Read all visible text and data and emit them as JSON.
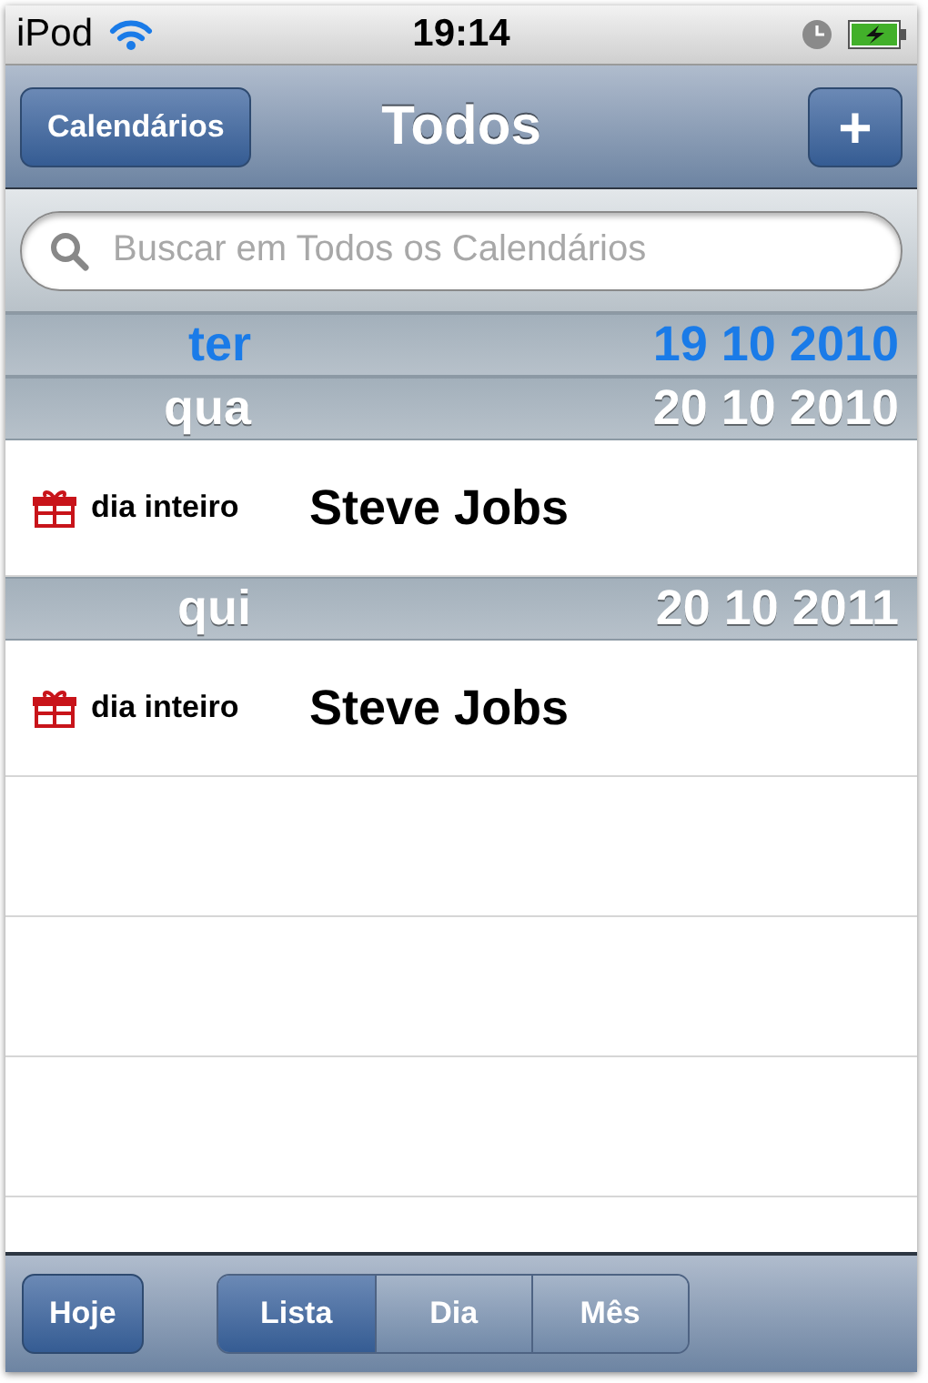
{
  "status_bar": {
    "device": "iPod",
    "time": "19:14"
  },
  "nav_bar": {
    "back_button": "Calendários",
    "title": "Todos",
    "add_button": "+"
  },
  "search": {
    "placeholder": "Buscar em Todos os Calendários"
  },
  "sections": [
    {
      "weekday": "ter",
      "date": "19 10 2010",
      "today": true
    },
    {
      "weekday": "qua",
      "date": "20 10 2010",
      "today": false,
      "events": [
        {
          "time": "dia inteiro",
          "title": "Steve Jobs"
        }
      ]
    },
    {
      "weekday": "qui",
      "date": "20 10 2011",
      "today": false,
      "events": [
        {
          "time": "dia inteiro",
          "title": "Steve Jobs"
        }
      ]
    }
  ],
  "toolbar": {
    "today_button": "Hoje",
    "segments": [
      {
        "label": "Lista",
        "selected": true
      },
      {
        "label": "Dia",
        "selected": false
      },
      {
        "label": "Mês",
        "selected": false
      }
    ]
  }
}
